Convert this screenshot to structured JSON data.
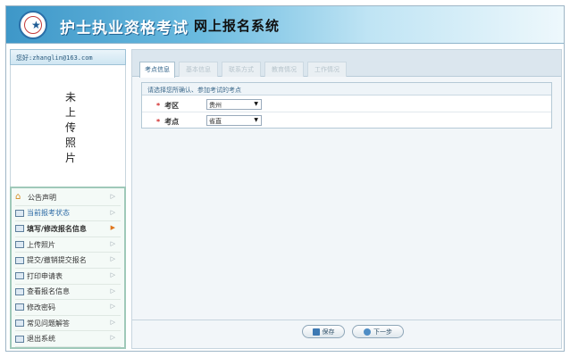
{
  "header": {
    "title_main": "护士执业资格考试",
    "title_sub": "网上报名系统",
    "logo_icon": "emblem-icon"
  },
  "sidebar": {
    "greeting": "您好:zhanglin@163.com",
    "photo_placeholder": "未上传照片",
    "photo_chars": [
      "未",
      "上",
      "传",
      "照",
      "片"
    ],
    "menu": [
      {
        "label": "公告声明",
        "icon": "home-icon",
        "active": false
      },
      {
        "label": "当前报考状态",
        "icon": "doc-icon",
        "active": false
      },
      {
        "label": "填写/修改报名信息",
        "icon": "doc-icon",
        "active": true
      },
      {
        "label": "上传照片",
        "icon": "doc-icon",
        "active": false
      },
      {
        "label": "提交/撤销提交报名",
        "icon": "page-icon",
        "active": false
      },
      {
        "label": "打印申请表",
        "icon": "page-icon",
        "active": false
      },
      {
        "label": "查看报名信息",
        "icon": "doc-icon",
        "active": false
      },
      {
        "label": "修改密码",
        "icon": "doc-icon",
        "active": false
      },
      {
        "label": "常见问题解答",
        "icon": "doc-icon",
        "active": false
      },
      {
        "label": "退出系统",
        "icon": "doc-icon",
        "active": false
      }
    ]
  },
  "tabs": [
    {
      "label": "考点信息",
      "active": true
    },
    {
      "label": "基本信息",
      "active": false
    },
    {
      "label": "联系方式",
      "active": false
    },
    {
      "label": "教育情况",
      "active": false
    },
    {
      "label": "工作情况",
      "active": false
    }
  ],
  "form": {
    "hint": "请选择您所确认、参加考试的考点",
    "fields": [
      {
        "label": "考区",
        "value": "贵州"
      },
      {
        "label": "考点",
        "value": "省直"
      }
    ]
  },
  "buttons": {
    "save": "保存",
    "next": "下一步"
  },
  "colors": {
    "header_start": "#3e97c8",
    "accent": "#2c5f86",
    "required": "#d12a2a",
    "active_arrow": "#e0761e"
  }
}
